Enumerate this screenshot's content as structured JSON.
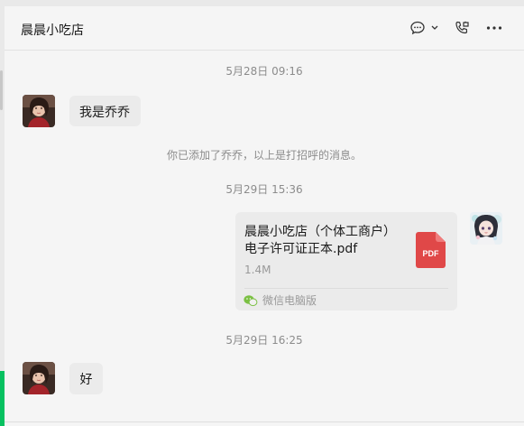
{
  "header": {
    "title": "晨晨小吃店",
    "icons": [
      "chat-bubble-icon",
      "chevron-down-icon",
      "voice-call-icon",
      "more-icon"
    ]
  },
  "messages": {
    "ts1": "5月28日 09:16",
    "msg1": "我是乔乔",
    "system": "你已添加了乔乔，以上是打招呼的消息。",
    "ts2": "5月29日 15:36",
    "file": {
      "name_line1": "晨晨小吃店（个体工商户）",
      "name_line2": "电子许可证正本.pdf",
      "size": "1.4M",
      "badge": "PDF",
      "source": "微信电脑版"
    },
    "ts3": "5月29日 16:25",
    "msg2": "好"
  },
  "colors": {
    "accent_green": "#07c160",
    "pdf_red": "#e04848",
    "bubble_bg": "#ebebeb"
  }
}
